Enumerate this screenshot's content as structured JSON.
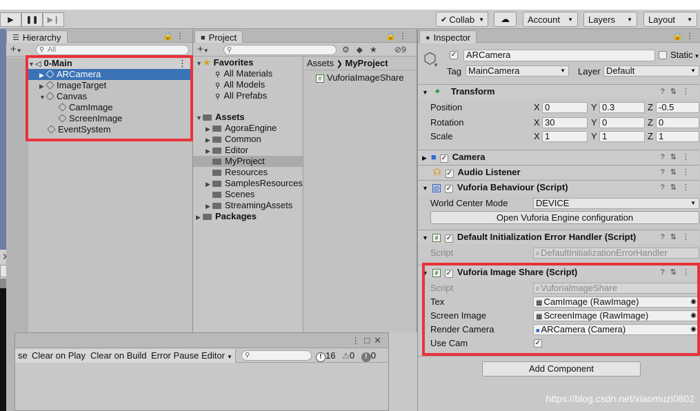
{
  "toolbar": {
    "collab": "Collab",
    "account": "Account",
    "layers": "Layers",
    "layout": "Layout"
  },
  "hierarchy": {
    "tab": "Hierarchy",
    "search_placeholder": "All",
    "scene": "0-Main",
    "items": [
      "ARCamera",
      "ImageTarget",
      "Canvas",
      "CamImage",
      "ScreenImage",
      "EventSystem"
    ]
  },
  "project": {
    "tab": "Project",
    "favorites": "Favorites",
    "fav_items": [
      "All Materials",
      "All Models",
      "All Prefabs"
    ],
    "assets": "Assets",
    "asset_items": [
      "AgoraEngine",
      "Common",
      "Editor",
      "MyProject",
      "Resources",
      "SamplesResources",
      "Scenes",
      "StreamingAssets"
    ],
    "packages": "Packages",
    "breadcrumb_root": "Assets",
    "breadcrumb_current": "MyProject",
    "file": "VuforiaImageShare",
    "hidden_count": "9"
  },
  "console": {
    "buttons": [
      "se",
      "Clear on Play",
      "Clear on Build",
      "Error Pause",
      "Editor"
    ],
    "count_log": "16",
    "count_warn": "0",
    "count_err": "0"
  },
  "inspector": {
    "tab": "Inspector",
    "object_name": "ARCamera",
    "static_label": "Static",
    "tag_label": "Tag",
    "tag_value": "MainCamera",
    "layer_label": "Layer",
    "layer_value": "Default",
    "transform": {
      "title": "Transform",
      "position_label": "Position",
      "rotation_label": "Rotation",
      "scale_label": "Scale",
      "axis_x": "X",
      "axis_y": "Y",
      "axis_z": "Z",
      "position": [
        "0",
        "0.3",
        "-0.5"
      ],
      "rotation": [
        "30",
        "0",
        "0"
      ],
      "scale": [
        "1",
        "1",
        "1"
      ]
    },
    "camera": "Camera",
    "audio": "Audio Listener",
    "vuforia_behaviour": {
      "title": "Vuforia Behaviour (Script)",
      "world_center_label": "World Center Mode",
      "world_center_value": "DEVICE",
      "open_button": "Open Vuforia Engine configuration"
    },
    "error_handler": {
      "title": "Default Initialization Error Handler (Script)",
      "script_label": "Script",
      "script_value": "DefaultInitializationErrorHandler"
    },
    "image_share": {
      "title": "Vuforia Image Share (Script)",
      "script_label": "Script",
      "script_value": "VuforialmageShare",
      "tex_label": "Tex",
      "tex_value": "CamImage (RawImage)",
      "screen_label": "Screen Image",
      "screen_value": "ScreenImage (RawImage)",
      "render_label": "Render Camera",
      "render_value": "ARCamera (Camera)",
      "usecam_label": "Use Cam"
    },
    "add_component": "Add Component"
  },
  "watermark": "https://blog.csdn.net/xiaomuzi0802"
}
